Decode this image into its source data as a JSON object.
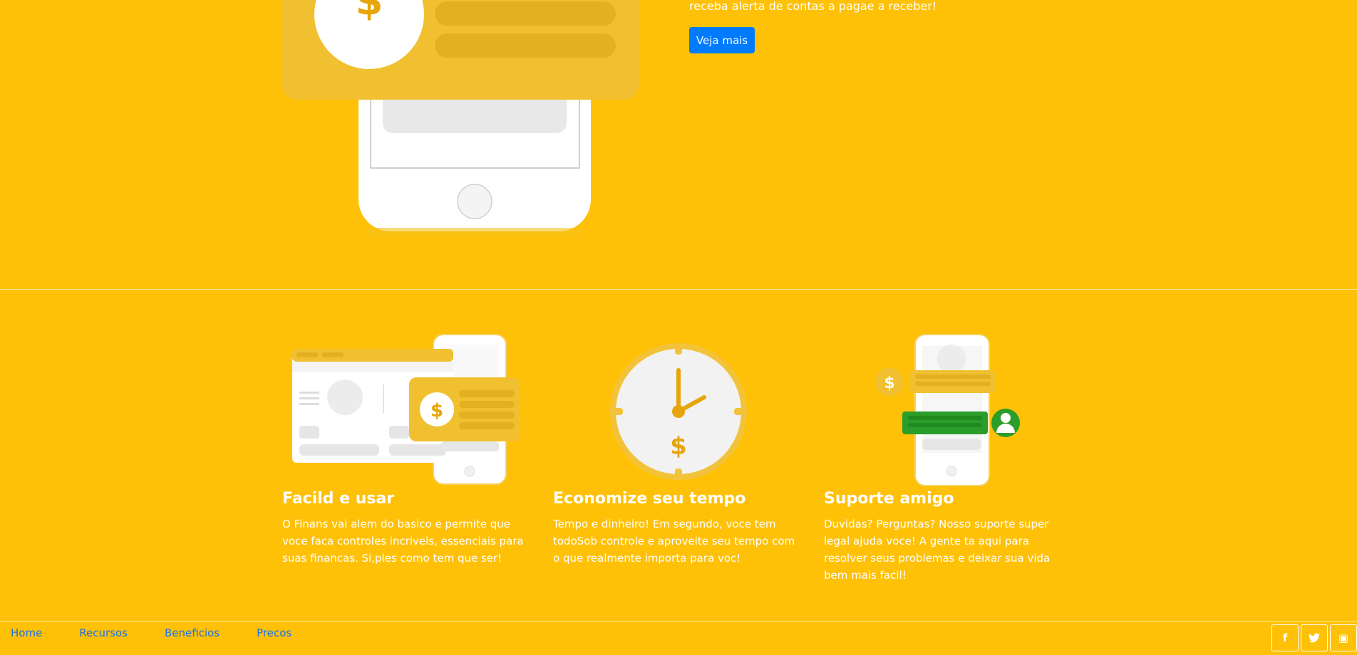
{
  "hero": {
    "text": "receba alerta de contas a pagae a receber!",
    "button_label": "Veja mais",
    "currency_symbol": "$"
  },
  "features": [
    {
      "title": "Facild e usar",
      "description": "O Finans vai alem do basico e permite que voce faca controles incriveis, essenciais para suas financas. Si,ples como tem que ser!",
      "icon": "dashboard-phone-illustration"
    },
    {
      "title": "Economize seu tempo",
      "description": "Tempo e dinheiro! Em segundo, voce tem todoSob controle e aproveite seu tempo com o que realmente importa para voc!",
      "icon": "clock-illustration"
    },
    {
      "title": "Suporte amigo",
      "description": "Duvidas? Perguntas? Nosso suporte super legal ajuda voce! A gente ta aqui para resolver seus problemas e deixar sua vida bem mais facil!",
      "icon": "chat-support-illustration"
    }
  ],
  "footer": {
    "nav": [
      "Home",
      "Recursos",
      "Beneficios",
      "Precos"
    ],
    "social": [
      {
        "name": "facebook-icon",
        "glyph": "f"
      },
      {
        "name": "twitter-icon",
        "glyph": "🐦"
      },
      {
        "name": "instagram-icon",
        "glyph": "▣"
      }
    ]
  },
  "colors": {
    "background": "#ffc107",
    "accent": "#007bff",
    "link": "#1a73e8",
    "card_yellow": "#f0c030",
    "support_green": "#2a9d2a"
  }
}
